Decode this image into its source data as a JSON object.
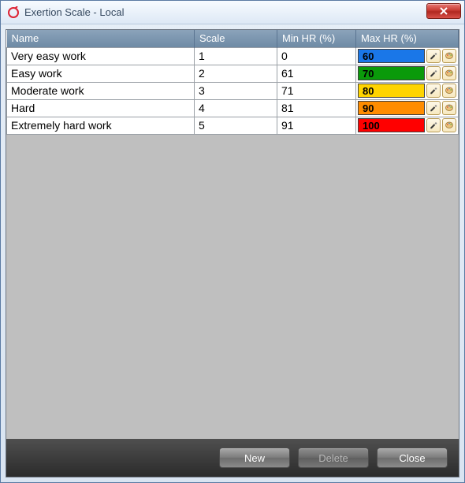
{
  "window": {
    "title": "Exertion Scale - Local"
  },
  "table": {
    "headers": {
      "name": "Name",
      "scale": "Scale",
      "min": "Min HR (%)",
      "max": "Max HR (%)"
    },
    "rows": [
      {
        "name": "Very easy work",
        "scale": "1",
        "min": "0",
        "max": "60",
        "color": "#1a77e8"
      },
      {
        "name": "Easy work",
        "scale": "2",
        "min": "61",
        "max": "70",
        "color": "#0a9a0a"
      },
      {
        "name": "Moderate work",
        "scale": "3",
        "min": "71",
        "max": "80",
        "color": "#ffd400"
      },
      {
        "name": "Hard",
        "scale": "4",
        "min": "81",
        "max": "90",
        "color": "#ff8c00"
      },
      {
        "name": "Extremely hard work",
        "scale": "5",
        "min": "91",
        "max": "100",
        "color": "#ff0000"
      }
    ]
  },
  "footer": {
    "new": "New",
    "delete": "Delete",
    "close": "Close"
  }
}
